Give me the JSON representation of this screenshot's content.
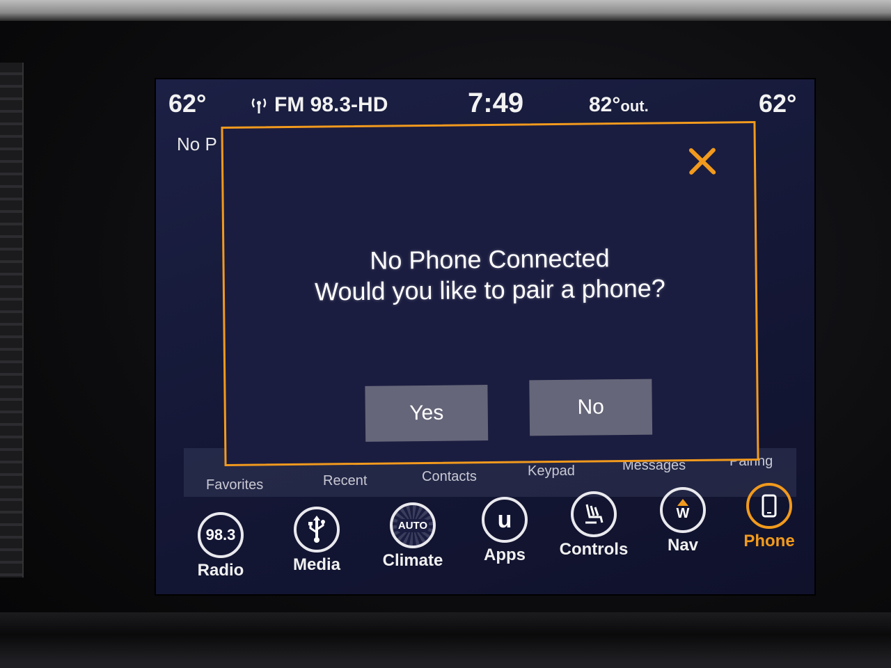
{
  "status": {
    "temp_left": "62°",
    "radio": "FM 98.3-HD",
    "time": "7:49",
    "outside_temp": "82°",
    "outside_suffix": "out.",
    "temp_right": "62°"
  },
  "background": {
    "label_partial": "No P"
  },
  "tabs": [
    "Favorites",
    "Recent",
    "Contacts",
    "Keypad",
    "Messages",
    "Pairing"
  ],
  "dock": {
    "radio": {
      "badge": "98.3",
      "label": "Radio"
    },
    "media": {
      "label": "Media"
    },
    "climate": {
      "badge": "AUTO",
      "label": "Climate"
    },
    "apps": {
      "badge": "u",
      "label": "Apps"
    },
    "controls": {
      "label": "Controls"
    },
    "nav": {
      "badge": "W",
      "label": "Nav"
    },
    "phone": {
      "label": "Phone"
    }
  },
  "dialog": {
    "title": "No Phone Connected",
    "question": "Would you like to pair a phone?",
    "yes_label": "Yes",
    "no_label": "No"
  },
  "colors": {
    "accent": "#f29a1d",
    "button_bg": "#66667a",
    "screen_bg": "#141735"
  },
  "icons": {
    "close": "close-icon",
    "antenna": "antenna-icon",
    "usb": "usb-icon",
    "climate": "climate-icon",
    "apps": "apps-icon",
    "controls": "seat-controls-icon",
    "nav": "compass-icon",
    "phone": "phone-icon"
  }
}
